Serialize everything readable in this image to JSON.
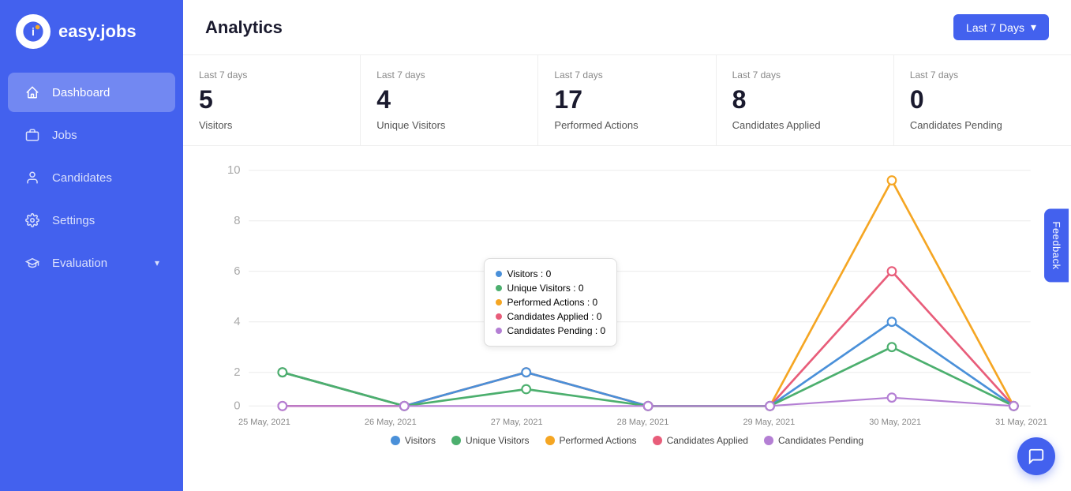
{
  "app": {
    "name": "easy.jobs"
  },
  "sidebar": {
    "nav_items": [
      {
        "id": "dashboard",
        "label": "Dashboard",
        "icon": "home-icon",
        "active": true
      },
      {
        "id": "jobs",
        "label": "Jobs",
        "icon": "briefcase-icon",
        "active": false
      },
      {
        "id": "candidates",
        "label": "Candidates",
        "icon": "person-icon",
        "active": false
      },
      {
        "id": "settings",
        "label": "Settings",
        "icon": "gear-icon",
        "active": false
      },
      {
        "id": "evaluation",
        "label": "Evaluation",
        "icon": "graduation-icon",
        "active": false,
        "has_chevron": true
      }
    ]
  },
  "header": {
    "title": "Analytics",
    "date_filter_label": "Last 7 Days"
  },
  "stats": [
    {
      "period": "Last 7 days",
      "value": "5",
      "label": "Visitors"
    },
    {
      "period": "Last 7 days",
      "value": "4",
      "label": "Unique Visitors"
    },
    {
      "period": "Last 7 days",
      "value": "17",
      "label": "Performed Actions"
    },
    {
      "period": "Last 7 days",
      "value": "8",
      "label": "Candidates Applied"
    },
    {
      "period": "Last 7 days",
      "value": "0",
      "label": "Candidates Pending"
    }
  ],
  "chart": {
    "x_labels": [
      "25 May, 2021",
      "26 May, 2021",
      "27 May, 2021",
      "28 May, 2021",
      "29 May, 2021",
      "30 May, 2021",
      "31 May, 2021"
    ],
    "y_max": 10,
    "legend": [
      {
        "label": "Visitors",
        "color": "#4a90d9"
      },
      {
        "label": "Unique Visitors",
        "color": "#4caf6e"
      },
      {
        "label": "Performed Actions",
        "color": "#f5a623"
      },
      {
        "label": "Candidates Applied",
        "color": "#e85d7a"
      },
      {
        "label": "Candidates Pending",
        "color": "#b47fd4"
      }
    ],
    "tooltip": {
      "items": [
        {
          "label": "Visitors",
          "value": 0,
          "color": "#4a90d9"
        },
        {
          "label": "Unique Visitors",
          "value": 0,
          "color": "#4caf6e"
        },
        {
          "label": "Performed Actions",
          "value": 0,
          "color": "#f5a623"
        },
        {
          "label": "Candidates Applied",
          "value": 0,
          "color": "#e85d7a"
        },
        {
          "label": "Candidates Pending",
          "value": 0,
          "color": "#b47fd4"
        }
      ]
    }
  },
  "feedback": {
    "label": "Feedback"
  },
  "chat": {
    "icon": "chat-icon"
  }
}
